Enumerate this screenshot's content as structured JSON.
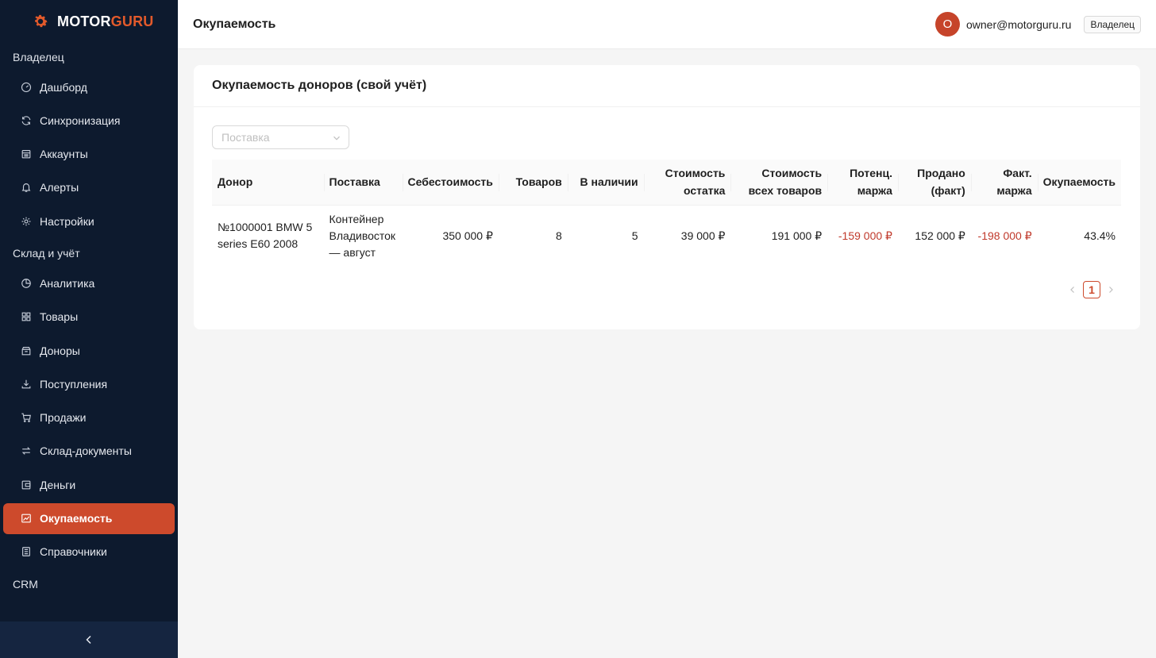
{
  "brand": {
    "part1": "MOTOR",
    "part2": "GURU",
    "accent": "#e25a2b"
  },
  "sidebar": {
    "sections": [
      {
        "title": "Владелец",
        "items": [
          {
            "label": "Дашборд",
            "icon": "dashboard-icon"
          },
          {
            "label": "Синхронизация",
            "icon": "sync-icon"
          },
          {
            "label": "Аккаунты",
            "icon": "accounts-icon"
          },
          {
            "label": "Алерты",
            "icon": "bell-icon"
          },
          {
            "label": "Настройки",
            "icon": "gear-icon"
          }
        ]
      },
      {
        "title": "Склад и учёт",
        "items": [
          {
            "label": "Аналитика",
            "icon": "pie-chart-icon"
          },
          {
            "label": "Товары",
            "icon": "grid-icon"
          },
          {
            "label": "Доноры",
            "icon": "box-icon"
          },
          {
            "label": "Поступления",
            "icon": "download-icon"
          },
          {
            "label": "Продажи",
            "icon": "cart-icon"
          },
          {
            "label": "Склад-документы",
            "icon": "swap-icon"
          },
          {
            "label": "Деньги",
            "icon": "wallet-icon"
          },
          {
            "label": "Окупаемость",
            "icon": "line-chart-icon",
            "active": true
          },
          {
            "label": "Справочники",
            "icon": "book-icon"
          }
        ]
      },
      {
        "title": "CRM",
        "items": []
      }
    ],
    "collapse_icon": "chevron-left-icon"
  },
  "header": {
    "title": "Окупаемость",
    "avatar_letter": "O",
    "email": "owner@motorguru.ru",
    "role": "Владелец",
    "accent": "#c6442a"
  },
  "card": {
    "title": "Окупаемость доноров (свой учёт)",
    "filter_placeholder": "Поставка",
    "columns": [
      {
        "label": "Донор",
        "align": "l"
      },
      {
        "label": "Поставка",
        "align": "l"
      },
      {
        "label": "Себестоимость",
        "align": "r"
      },
      {
        "label": "Товаров",
        "align": "r"
      },
      {
        "label": "В наличии",
        "align": "r"
      },
      {
        "label": "Стоимость остатка",
        "align": "r"
      },
      {
        "label": "Стоимость всех товаров",
        "align": "r"
      },
      {
        "label": "Потенц. маржа",
        "align": "r"
      },
      {
        "label": "Продано (факт)",
        "align": "r"
      },
      {
        "label": "Факт. маржа",
        "align": "r"
      },
      {
        "label": "Окупаемость",
        "align": "r"
      }
    ],
    "rows": [
      {
        "donor": "№1000001 BMW 5 series E60 2008",
        "supply": "Контейнер Владивосток — август",
        "cost": "350 000 ₽",
        "items": "8",
        "in_stock": "5",
        "stock_value": "39 000 ₽",
        "all_value": "191 000 ₽",
        "potential_margin": "-159 000 ₽",
        "sold": "152 000 ₽",
        "fact_margin": "-198 000 ₽",
        "payback": "43.4%"
      }
    ],
    "negative_color": "#c0392b",
    "pagination": {
      "current": "1"
    }
  }
}
